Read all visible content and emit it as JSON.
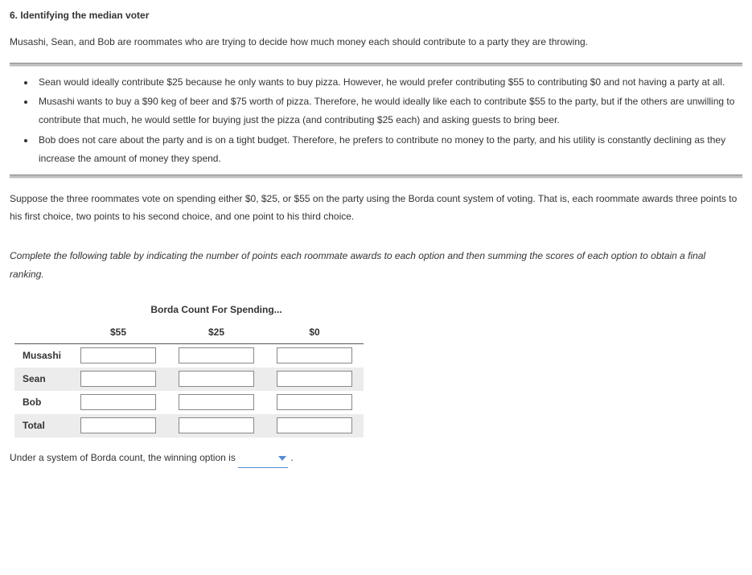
{
  "title": "6. Identifying the median voter",
  "intro": "Musashi, Sean, and Bob are roommates who are trying to decide how much money each should contribute to a party they are throwing.",
  "bullets": [
    "Sean would ideally contribute $25 because he only wants to buy pizza. However, he would prefer contributing $55 to contributing $0 and not having a party at all.",
    "Musashi wants to buy a $90 keg of beer and $75 worth of pizza. Therefore, he would ideally like each to contribute $55 to the party, but if the others are unwilling to contribute that much, he would settle for buying just the pizza (and contributing $25 each) and asking guests to bring beer.",
    "Bob does not care about the party and is on a tight budget. Therefore, he prefers to contribute no money to the party, and his utility is constantly declining as they increase the amount of money they spend."
  ],
  "voting_para": "Suppose the three roommates vote on spending either $0, $25, or $55 on the party using the Borda count system of voting. That is, each roommate awards three points to his first choice, two points to his second choice, and one point to his third choice.",
  "instruction": "Complete the following table by indicating the number of points each roommate awards to each option and then summing the scores of each option to obtain a final ranking.",
  "table": {
    "overhead": "Borda Count For Spending...",
    "cols": [
      "$55",
      "$25",
      "$0"
    ],
    "rows": [
      "Musashi",
      "Sean",
      "Bob",
      "Total"
    ]
  },
  "conclusion_prefix": "Under a system of Borda count, the winning option is",
  "conclusion_suffix": ".",
  "dropdown_value": ""
}
